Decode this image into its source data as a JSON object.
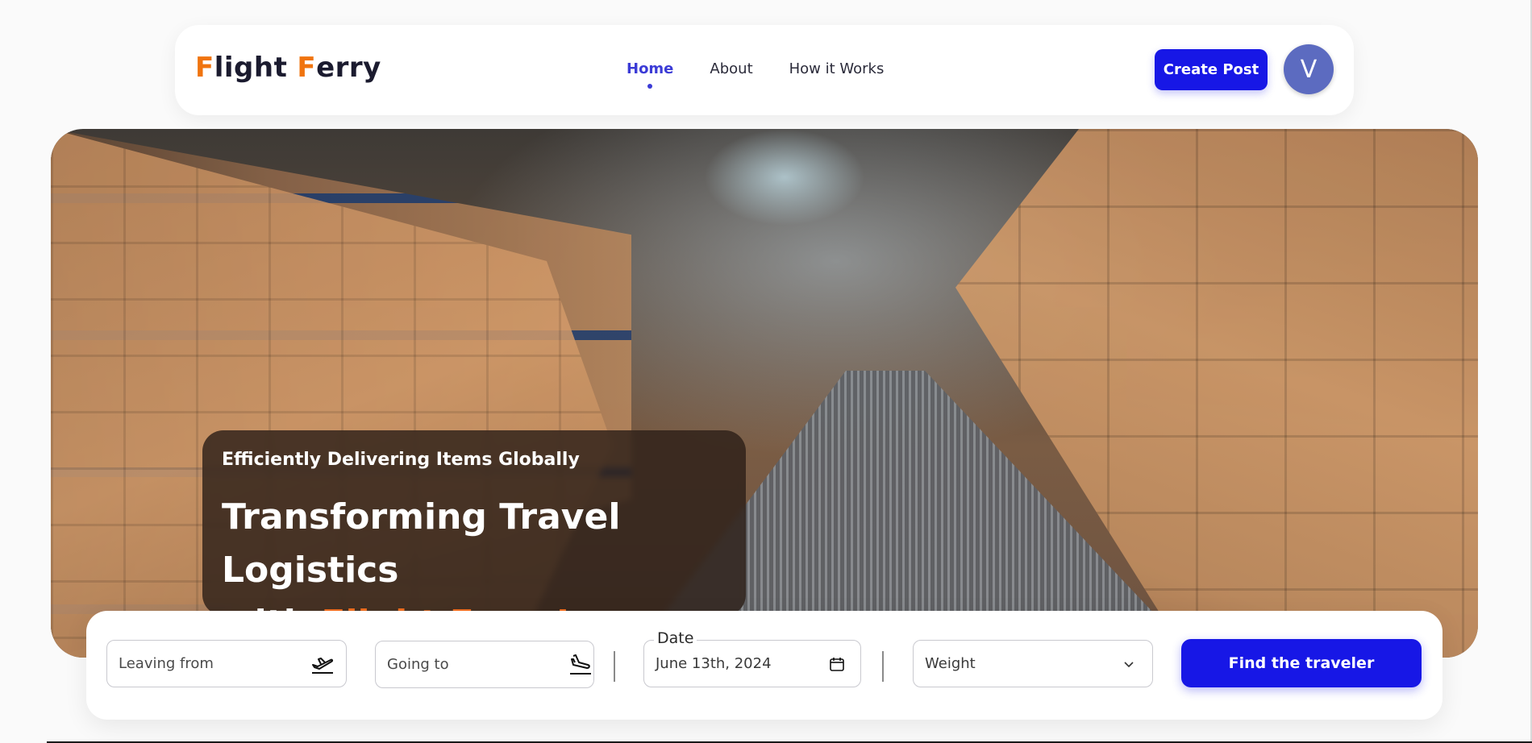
{
  "brand": {
    "logo_first_initial": "F",
    "logo_first_rest": "light",
    "logo_second_initial": "F",
    "logo_second_rest": "erry",
    "accent_color": "#f0740f"
  },
  "nav": {
    "links": [
      {
        "label": "Home",
        "active": true
      },
      {
        "label": "About",
        "active": false
      },
      {
        "label": "How it Works",
        "active": false
      }
    ],
    "active_color": "#3b3bd6"
  },
  "header_actions": {
    "create_post_label": "Create Post",
    "avatar_initial": "V",
    "primary_color": "#1717e6"
  },
  "hero": {
    "subtitle": "Efficiently Delivering Items Globally",
    "title_line1": "Transforming Travel Logistics",
    "title_line2_prefix": "with ",
    "title_highlight": "Flight Ferry!",
    "highlight_color": "#f37021"
  },
  "search": {
    "leaving_placeholder": "Leaving from",
    "leaving_icon": "airplane-takeoff-icon",
    "going_placeholder": "Going to",
    "going_icon": "airplane-landing-icon",
    "date_label": "Date",
    "date_value": "June 13th, 2024",
    "date_icon": "calendar-icon",
    "weight_placeholder": "Weight",
    "weight_icon": "chevron-down-icon",
    "find_label": "Find the traveler"
  }
}
